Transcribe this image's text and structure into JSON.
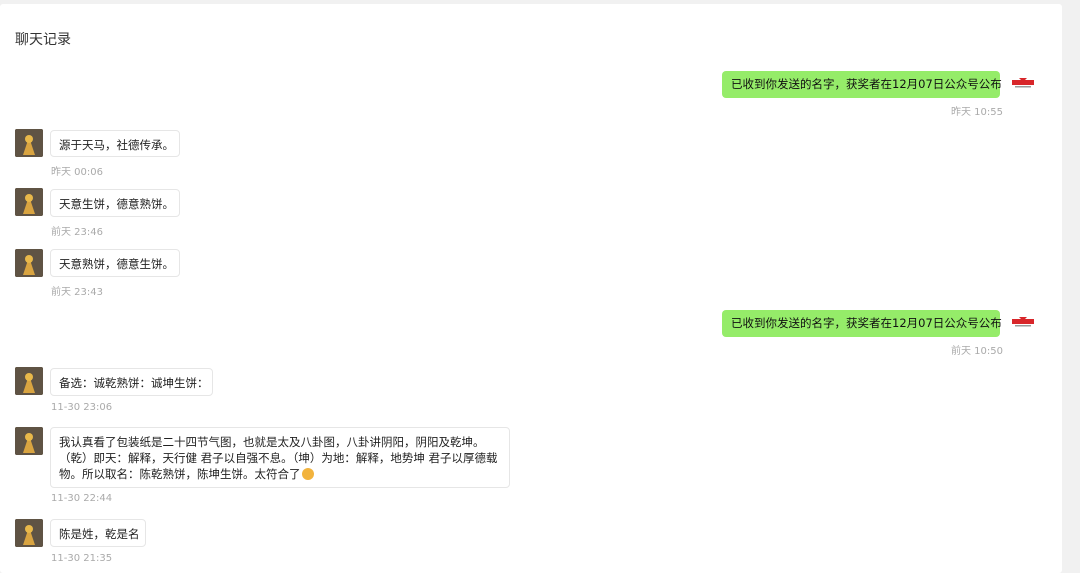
{
  "header": {
    "title": "聊天记录"
  },
  "messages": [
    {
      "direction": "out",
      "text": "已收到你发送的名字，获奖者在12月07日公众号公布",
      "time": "昨天 10:55",
      "avatar": "brand-logo-icon"
    },
    {
      "direction": "in",
      "text": "源于天马，社德传承。",
      "time": "昨天 00:06",
      "avatar": "user-avatar"
    },
    {
      "direction": "in",
      "text": "天意生饼，德意熟饼。",
      "time": "前天 23:46",
      "avatar": "user-avatar"
    },
    {
      "direction": "in",
      "text": "天意熟饼，德意生饼。",
      "time": "前天 23:43",
      "avatar": "user-avatar"
    },
    {
      "direction": "out",
      "text": "已收到你发送的名字，获奖者在12月07日公众号公布",
      "time": "前天 10:50",
      "avatar": "brand-logo-icon"
    },
    {
      "direction": "in",
      "text": "备选：诚乾熟饼：诚坤生饼：",
      "time": "11-30 23:06",
      "avatar": "user-avatar"
    },
    {
      "direction": "in",
      "lines": [
        "我认真看了包装纸是二十四节气图，也就是太及八卦图，八卦讲阴阳，阴阳及乾坤。",
        "（乾）即天：解释，天行健 君子以自强不息。（坤）为地：解释，地势坤 君子以厚德载",
        "物。所以取名：陈乾熟饼，陈坤生饼。太符合了"
      ],
      "emoji": "grin-emoji-icon",
      "time": "11-30 22:44",
      "avatar": "user-avatar"
    },
    {
      "direction": "in",
      "text": "陈是姓，乾是名",
      "time": "11-30 21:35",
      "avatar": "user-avatar"
    }
  ],
  "colors": {
    "out_bubble": "#95ec69",
    "in_bubble": "#ffffff",
    "time": "#aaaaaa"
  }
}
